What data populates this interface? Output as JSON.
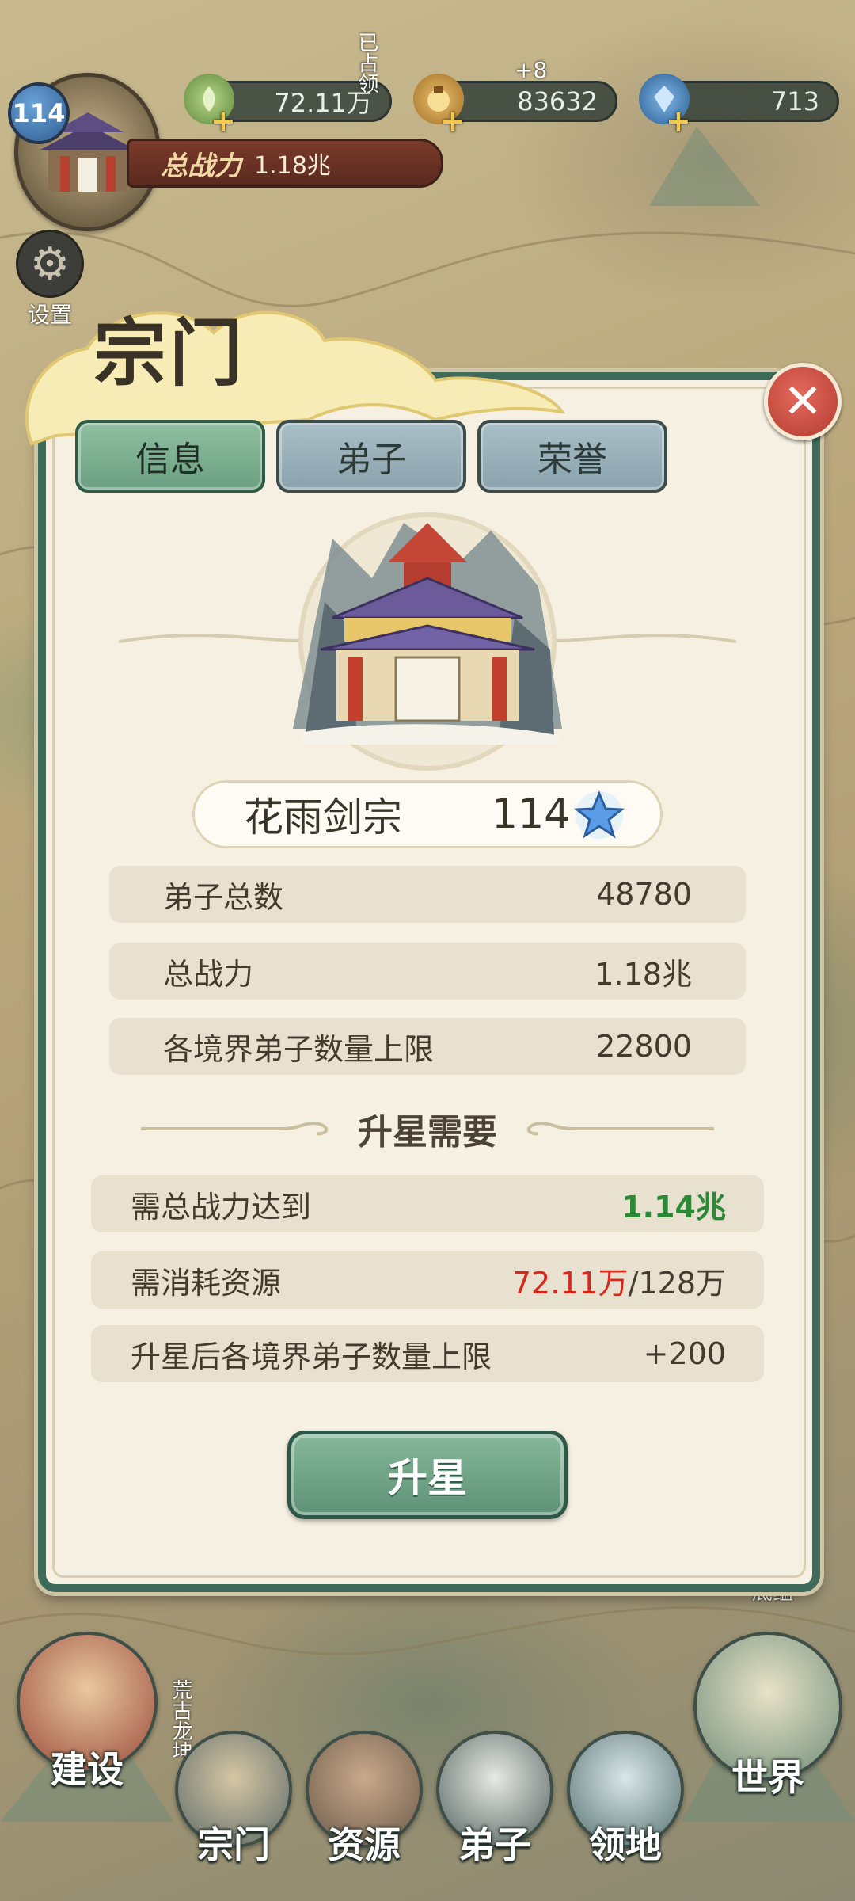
{
  "hud": {
    "player_level": "114",
    "power_label": "总战力",
    "power_value": "1.18兆",
    "resources": [
      {
        "icon": "herb-icon",
        "value": "72.11万"
      },
      {
        "icon": "coin-bag-icon",
        "value": "83632",
        "bonus": "+8"
      },
      {
        "icon": "crystal-icon",
        "value": "713"
      }
    ],
    "settings_label": "设置"
  },
  "modal": {
    "title": "宗门",
    "tabs": [
      {
        "label": "信息",
        "active": true
      },
      {
        "label": "弟子",
        "active": false
      },
      {
        "label": "荣誉",
        "active": false
      }
    ],
    "sect_name": "花雨剑宗",
    "sect_level": "114",
    "info_rows": [
      {
        "label": "弟子总数",
        "value": "48780"
      },
      {
        "label": "总战力",
        "value": "1.18兆"
      },
      {
        "label": "各境界弟子数量上限",
        "value": "22800"
      }
    ],
    "upgrade_section_title": "升星需要",
    "requirements": {
      "power_label": "需总战力达到",
      "power_value": "1.14兆",
      "resource_label": "需消耗资源",
      "resource_current": "72.11万",
      "resource_required": "/128万",
      "limit_label": "升星后各境界弟子数量上限",
      "limit_value": "+200"
    },
    "upgrade_button": "升星"
  },
  "bottom_nav": [
    {
      "label": "建设",
      "icon": "build-icon"
    },
    {
      "label": "宗门",
      "icon": "sect-icon"
    },
    {
      "label": "资源",
      "icon": "resource-icon"
    },
    {
      "label": "弟子",
      "icon": "disciple-icon"
    },
    {
      "label": "领地",
      "icon": "territory-icon"
    },
    {
      "label": "世界",
      "icon": "world-icon"
    }
  ],
  "map_labels": {
    "occupied": "已占领",
    "wilderness": "荒古龙坤",
    "bottom_edge": "底蕴"
  },
  "colors": {
    "modal_border": "#3e6a5a",
    "tab_active": "#6c9f82",
    "tab_inactive": "#8aa2ad",
    "requirement_met": "#2c8a36",
    "requirement_unmet": "#d8281e",
    "close_button": "#b13b30"
  }
}
